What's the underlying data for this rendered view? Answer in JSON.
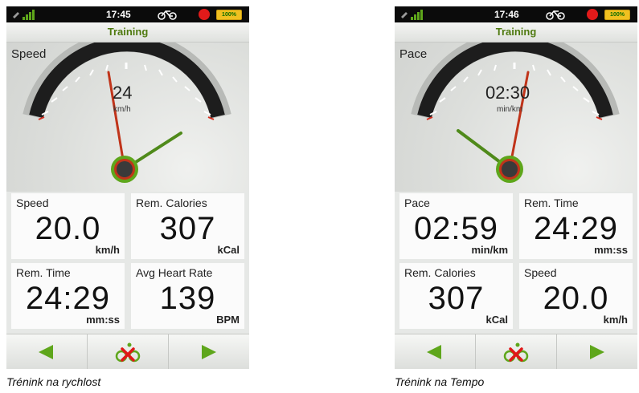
{
  "screens": [
    {
      "status": {
        "time": "17:45",
        "battery": "100%"
      },
      "title": "Training",
      "gauge": {
        "label": "Speed",
        "value": "24",
        "unit": "km/h"
      },
      "tiles": [
        {
          "label": "Speed",
          "value": "20.0",
          "unit": "km/h"
        },
        {
          "label": "Rem. Calories",
          "value": "307",
          "unit": "kCal"
        },
        {
          "label": "Rem. Time",
          "value": "24:29",
          "unit": "mm:ss"
        },
        {
          "label": "Avg Heart Rate",
          "value": "139",
          "unit": "BPM"
        }
      ],
      "caption": "Trénink na rychlost"
    },
    {
      "status": {
        "time": "17:46",
        "battery": "100%"
      },
      "title": "Training",
      "gauge": {
        "label": "Pace",
        "value": "02:30",
        "unit": "min/km"
      },
      "tiles": [
        {
          "label": "Pace",
          "value": "02:59",
          "unit": "min/km"
        },
        {
          "label": "Rem. Time",
          "value": "24:29",
          "unit": "mm:ss"
        },
        {
          "label": "Rem. Calories",
          "value": "307",
          "unit": "kCal"
        },
        {
          "label": "Speed",
          "value": "20.0",
          "unit": "km/h"
        }
      ],
      "caption": "Trénink na Tempo"
    }
  ],
  "icons": {
    "back": "arrow-left-icon",
    "stop": "stop-training-icon",
    "forward": "arrow-right-icon",
    "signal": "gps-signal-icon",
    "bike": "bicycle-icon",
    "record": "record-icon",
    "battery": "battery-icon"
  },
  "colors": {
    "accent_green": "#5ea61b",
    "title_green": "#4f7a10",
    "needle_red": "#c0341a",
    "record_red": "#e21a1a"
  }
}
